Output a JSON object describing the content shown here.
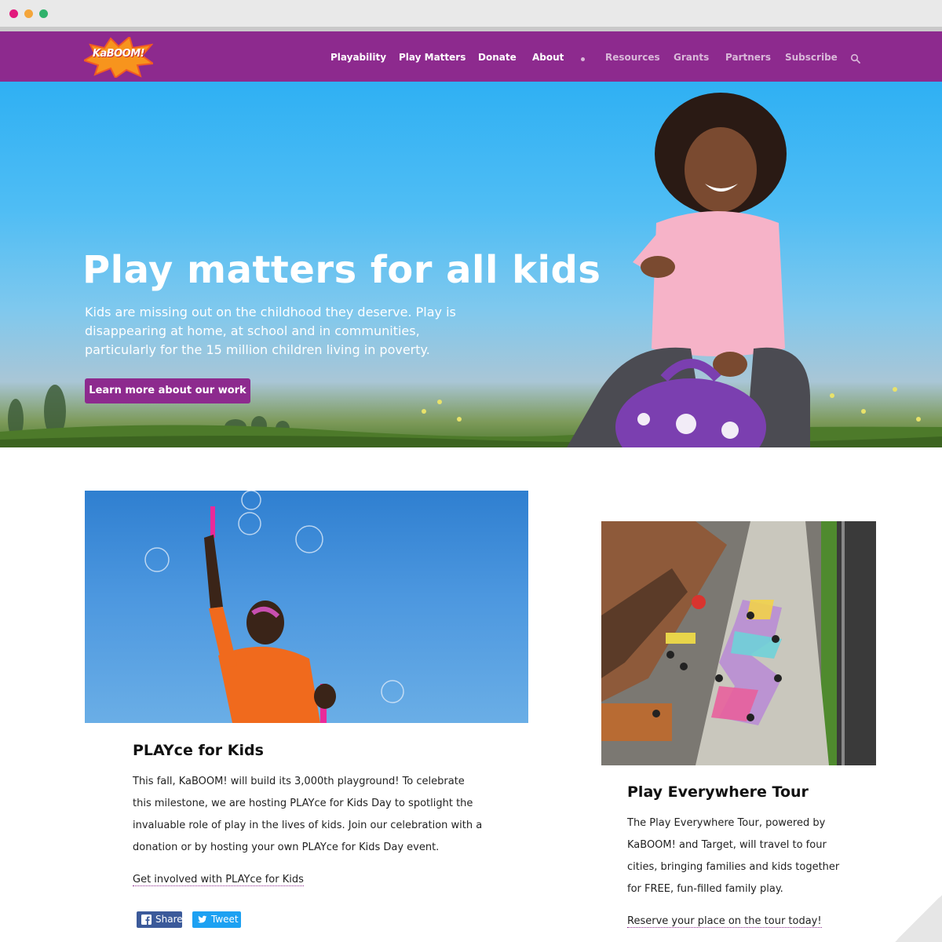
{
  "brand": {
    "logo_text": "KaBOOM!",
    "primary_color": "#8d2a8e"
  },
  "nav": {
    "items": [
      {
        "label": "Playability",
        "icon": null
      },
      {
        "label": "Play Matters",
        "icon": null
      },
      {
        "label": "Donate",
        "icon": null
      },
      {
        "label": "About",
        "icon": null
      },
      {
        "label": "Resources",
        "icon": null
      },
      {
        "label": "Grants",
        "icon": null
      },
      {
        "label": "Partners",
        "icon": null
      },
      {
        "label": "Subscribe",
        "icon": null
      }
    ],
    "search_icon": "search-icon"
  },
  "hero": {
    "title": "Play matters for all kids",
    "body": "Kids are missing out on the childhood they deserve. Play is disappearing at home, at school and in communities, particularly for the 15 million children living in poverty.",
    "cta": "Learn more about our work"
  },
  "cards": [
    {
      "title": "PLAYce for Kids",
      "body": "This fall, KaBOOM! will build its 3,000th playground! To celebrate this milestone, we are hosting PLAYce for Kids Day to spotlight the invaluable role of play in the lives of kids. Join our celebration with a donation or by hosting your own PLAYce for Kids Day event.",
      "link": "Get involved with PLAYce for Kids"
    },
    {
      "title": "Play Everywhere Tour",
      "body": "The Play Everywhere Tour, powered by KaBOOM! and Target, will travel to four cities, bringing families and kids together for FREE, fun-filled family play.",
      "link": "Reserve your place on the tour today!"
    }
  ],
  "share": {
    "facebook_label": "Share",
    "twitter_label": "Tweet"
  }
}
